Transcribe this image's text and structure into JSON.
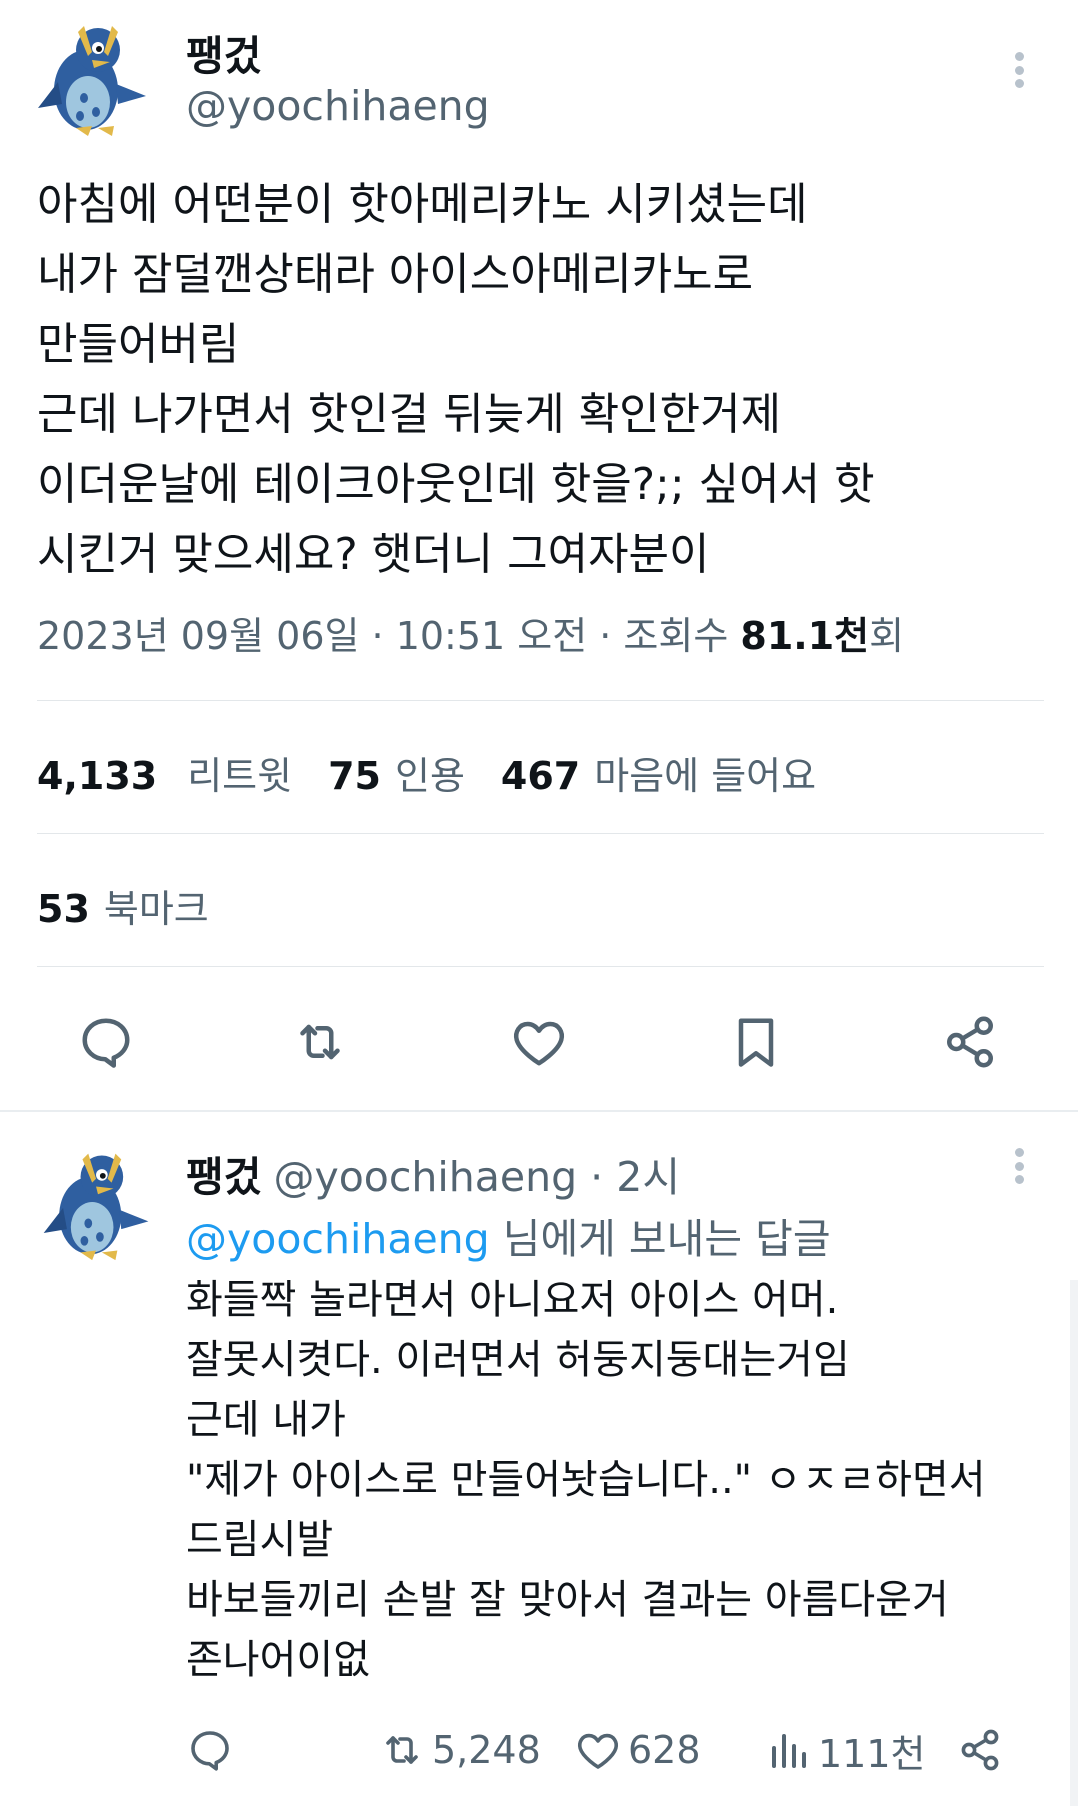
{
  "main_tweet": {
    "author": {
      "display_name": "팽겄",
      "handle": "@yoochihaeng",
      "avatar_icon": "penguin-avatar-icon"
    },
    "more_icon": "more-options-icon",
    "text_lines": [
      "아침에 어떤분이 핫아메리카노 시키셨는데",
      "내가 잠덜깬상태라 아이스아메리카노로",
      "만들어버림",
      "근데 나가면서 핫인걸 뒤늦게 확인한거제",
      "이더운날에 테이크아웃인데 핫을?;; 싶어서 핫",
      "시킨거 맞으세요? 햇더니 그여자분이"
    ],
    "timestamp": "2023년 09월 06일 · 10:51 오전 · 조회수 ",
    "views_number": "81.1천",
    "views_suffix": "회",
    "stats": {
      "retweets_count": "4,133",
      "retweets_label": "리트윗",
      "quotes_count": "75",
      "quotes_label": "인용",
      "likes_count": "467",
      "likes_label": "마음에 들어요",
      "bookmarks_count": "53",
      "bookmarks_label": "북마크"
    },
    "actions": [
      "reply-icon",
      "retweet-icon",
      "like-icon",
      "bookmark-icon",
      "share-icon"
    ]
  },
  "reply_tweet": {
    "author": {
      "display_name": "팽겄",
      "handle": "@yoochihaeng · 2시",
      "avatar_icon": "penguin-avatar-icon"
    },
    "replying_to_mention": "@yoochihaeng",
    "replying_to_suffix": " 님에게 보내는 답글",
    "text_lines": [
      "화들짝 놀라면서 아니요저 아이스 어머.",
      "잘못시켯다. 이러면서 허둥지둥대는거임",
      "근데 내가",
      "\"제가 아이스로 만들어놧습니다..\" ㅇㅈㄹ하면서",
      "드림시발",
      "바보들끼리 손발 잘 맞아서 결과는 아름다운거",
      "존나어이없"
    ],
    "actions": {
      "reply_icon": "reply-icon",
      "retweet_count": "5,248",
      "like_count": "628",
      "views_count": "111천",
      "share_icon": "share-icon"
    }
  },
  "colors": {
    "text_primary": "#0f1419",
    "text_secondary": "#536471",
    "link": "#1d9bf0",
    "divider": "#e3e7ea",
    "penguin_blue": "#2f5fa0",
    "penguin_gold": "#e2b94a"
  }
}
